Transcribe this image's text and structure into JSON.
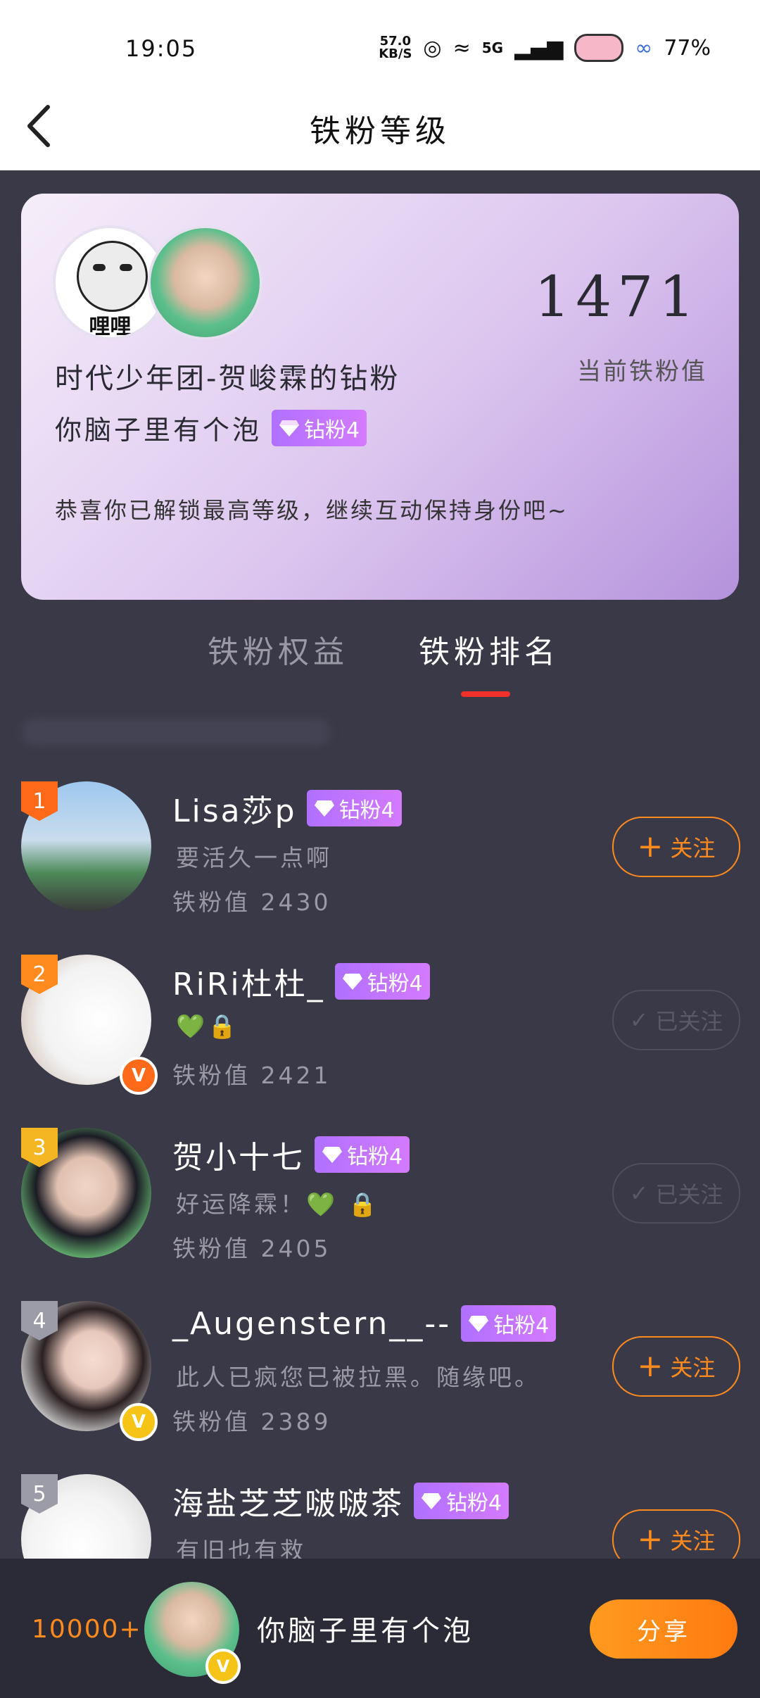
{
  "status": {
    "time": "19:05",
    "speed_value": "57.0",
    "speed_unit": "KB/S",
    "network": "5G",
    "battery": "77%"
  },
  "header": {
    "title": "铁粉等级"
  },
  "card": {
    "meme_text": "哩哩",
    "group_title": "时代少年团-贺峻霖的钻粉",
    "username": "你脑子里有个泡",
    "badge": "钻粉4",
    "score": "1471",
    "score_label": "当前铁粉值",
    "message": "恭喜你已解锁最高等级，继续互动保持身份吧~"
  },
  "tabs": [
    {
      "label": "铁粉权益"
    },
    {
      "label": "铁粉排名"
    }
  ],
  "rows": [
    {
      "rank": "1",
      "name": "Lisa莎p",
      "badge": "钻粉4",
      "signature": "要活久一点啊",
      "score": "铁粉值 2430",
      "button": "关注"
    },
    {
      "rank": "2",
      "name": "RiRi杜杜_",
      "badge": "钻粉4",
      "signature": "💚🔒",
      "score": "铁粉值 2421",
      "button": "已关注"
    },
    {
      "rank": "3",
      "name": "贺小十七",
      "badge": "钻粉4",
      "signature": "好运降霖！💚 🔒",
      "score": "铁粉值 2405",
      "button": "已关注"
    },
    {
      "rank": "4",
      "name": "_Augenstern__--",
      "badge": "钻粉4",
      "signature": "此人已疯您已被拉黑。随缘吧。",
      "score": "铁粉值 2389",
      "button": "关注"
    },
    {
      "rank": "5",
      "name": "海盐芝芝啵啵茶",
      "badge": "钻粉4",
      "signature": "有旧也有救",
      "score": "",
      "button": "关注"
    }
  ],
  "bottom": {
    "rank": "10000+",
    "name": "你脑子里有个泡",
    "share": "分享"
  },
  "colors": {
    "accent": "#ff8a1e",
    "tab_indicator": "#f0302a",
    "background": "#3a3947"
  }
}
